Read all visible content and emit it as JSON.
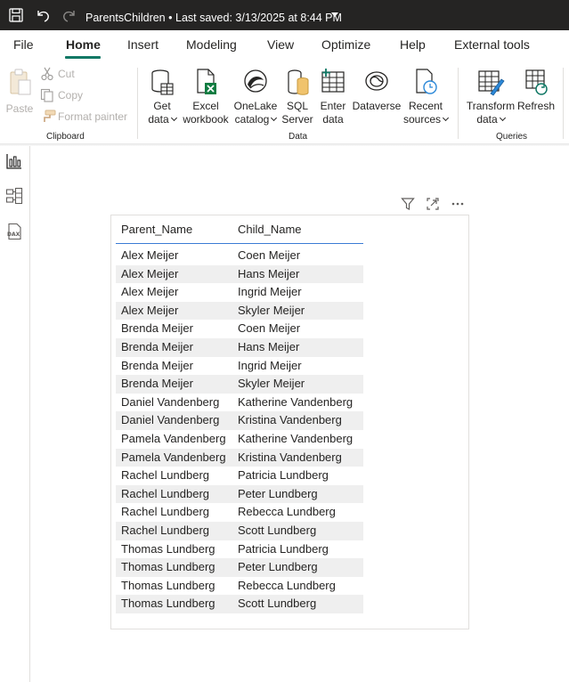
{
  "titlebar": {
    "file_name": "ParentsChildren",
    "separator": "•",
    "saved_text": "Last saved: 3/13/2025 at 8:44 PM"
  },
  "menu": {
    "tabs": [
      {
        "label": "File",
        "active": false
      },
      {
        "label": "Home",
        "active": true
      },
      {
        "label": "Insert",
        "active": false
      },
      {
        "label": "Modeling",
        "active": false
      },
      {
        "label": "View",
        "active": false
      },
      {
        "label": "Optimize",
        "active": false
      },
      {
        "label": "Help",
        "active": false
      },
      {
        "label": "External tools",
        "active": false
      }
    ]
  },
  "ribbon": {
    "clipboard": {
      "group_label": "Clipboard",
      "paste": "Paste",
      "cut": "Cut",
      "copy": "Copy",
      "format_painter": "Format painter"
    },
    "data": {
      "group_label": "Data",
      "get_data": [
        "Get",
        "data"
      ],
      "excel": [
        "Excel",
        "workbook"
      ],
      "onelake": [
        "OneLake",
        "catalog"
      ],
      "sql": [
        "SQL",
        "Server"
      ],
      "enter": [
        "Enter",
        "data"
      ],
      "dataverse": "Dataverse",
      "recent": [
        "Recent",
        "sources"
      ]
    },
    "queries": {
      "group_label": "Queries",
      "transform": [
        "Transform",
        "data"
      ],
      "refresh": "Refresh"
    }
  },
  "table": {
    "columns": [
      "Parent_Name",
      "Child_Name"
    ],
    "rows": [
      [
        "Alex Meijer",
        "Coen Meijer"
      ],
      [
        "Alex Meijer",
        "Hans Meijer"
      ],
      [
        "Alex Meijer",
        "Ingrid Meijer"
      ],
      [
        "Alex Meijer",
        "Skyler Meijer"
      ],
      [
        "Brenda Meijer",
        "Coen Meijer"
      ],
      [
        "Brenda Meijer",
        "Hans Meijer"
      ],
      [
        "Brenda Meijer",
        "Ingrid Meijer"
      ],
      [
        "Brenda Meijer",
        "Skyler Meijer"
      ],
      [
        "Daniel Vandenberg",
        "Katherine Vandenberg"
      ],
      [
        "Daniel Vandenberg",
        "Kristina Vandenberg"
      ],
      [
        "Pamela Vandenberg",
        "Katherine Vandenberg"
      ],
      [
        "Pamela Vandenberg",
        "Kristina Vandenberg"
      ],
      [
        "Rachel Lundberg",
        "Patricia Lundberg"
      ],
      [
        "Rachel Lundberg",
        "Peter Lundberg"
      ],
      [
        "Rachel Lundberg",
        "Rebecca Lundberg"
      ],
      [
        "Rachel Lundberg",
        "Scott Lundberg"
      ],
      [
        "Thomas Lundberg",
        "Patricia Lundberg"
      ],
      [
        "Thomas Lundberg",
        "Peter Lundberg"
      ],
      [
        "Thomas Lundberg",
        "Rebecca Lundberg"
      ],
      [
        "Thomas Lundberg",
        "Scott Lundberg"
      ]
    ]
  },
  "colors": {
    "titlebar_bg": "#252423",
    "accent_green": "#117865",
    "header_underline": "#3a7bd5",
    "row_alt": "#efefef"
  }
}
